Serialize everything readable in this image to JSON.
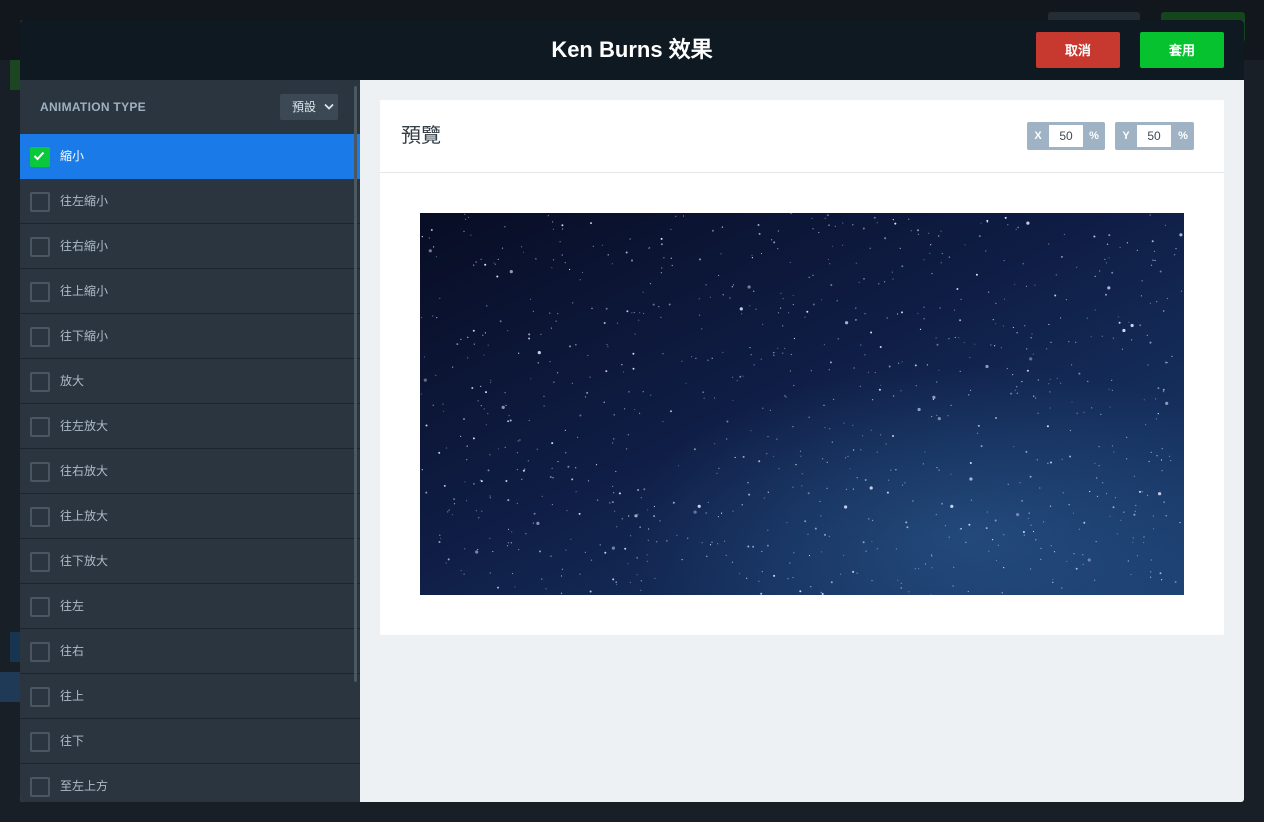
{
  "modal": {
    "title": "Ken Burns 效果",
    "cancel_label": "取消",
    "apply_label": "套用"
  },
  "sidebar": {
    "section_label": "ANIMATION TYPE",
    "preset_value": "預設",
    "items": [
      {
        "label": "縮小",
        "checked": true
      },
      {
        "label": "往左縮小",
        "checked": false
      },
      {
        "label": "往右縮小",
        "checked": false
      },
      {
        "label": "往上縮小",
        "checked": false
      },
      {
        "label": "往下縮小",
        "checked": false
      },
      {
        "label": "放大",
        "checked": false
      },
      {
        "label": "往左放大",
        "checked": false
      },
      {
        "label": "往右放大",
        "checked": false
      },
      {
        "label": "往上放大",
        "checked": false
      },
      {
        "label": "往下放大",
        "checked": false
      },
      {
        "label": "往左",
        "checked": false
      },
      {
        "label": "往右",
        "checked": false
      },
      {
        "label": "往上",
        "checked": false
      },
      {
        "label": "往下",
        "checked": false
      },
      {
        "label": "至左上方",
        "checked": false
      }
    ]
  },
  "preview": {
    "title": "預覽",
    "x_axis": "X",
    "x_value": "50",
    "y_axis": "Y",
    "y_value": "50",
    "unit": "%"
  },
  "colors": {
    "selected": "#1a7ae8",
    "check": "#0ac83c",
    "cancel": "#c7392f",
    "apply": "#06c22f"
  }
}
